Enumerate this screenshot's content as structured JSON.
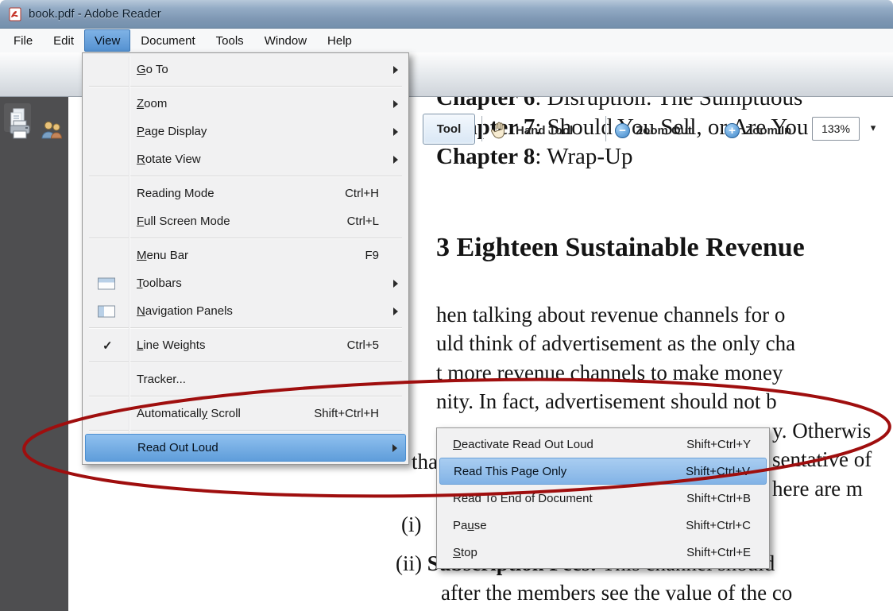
{
  "window": {
    "title": "book.pdf - Adobe Reader"
  },
  "menubar": {
    "items": [
      {
        "label": "File"
      },
      {
        "label": "Edit"
      },
      {
        "label": "View",
        "state": "open"
      },
      {
        "label": "Document"
      },
      {
        "label": "Tools"
      },
      {
        "label": "Window"
      },
      {
        "label": "Help"
      }
    ]
  },
  "toolbar": {
    "tool_button_label": "Tool",
    "hand_tool_label": "Hand Tool",
    "zoom_out_label": "Zoom Out",
    "zoom_in_label": "Zoom In",
    "zoom_value": "133%"
  },
  "glyphs": {
    "check": "✓",
    "dropdown_arrow": "▾",
    "minus": "−",
    "plus": "+"
  },
  "view_menu": {
    "items": [
      {
        "label": "Go To",
        "mnemonic": "G",
        "has_submenu": true
      },
      {
        "label": "Zoom",
        "mnemonic": "Z",
        "has_submenu": true
      },
      {
        "label": "Page Display",
        "mnemonic": "P",
        "has_submenu": true
      },
      {
        "label": "Rotate View",
        "mnemonic": "R",
        "has_submenu": true
      },
      {
        "label": "Reading Mode",
        "shortcut": "Ctrl+H"
      },
      {
        "label": "Full Screen Mode",
        "mnemonic": "F",
        "shortcut": "Ctrl+L"
      },
      {
        "label": "Menu Bar",
        "mnemonic": "M",
        "shortcut": "F9"
      },
      {
        "label": "Toolbars",
        "mnemonic": "T",
        "has_submenu": true
      },
      {
        "label": "Navigation Panels",
        "mnemonic": "N",
        "has_submenu": true
      },
      {
        "label": "Line Weights",
        "mnemonic": "L",
        "shortcut": "Ctrl+5",
        "checked": true
      },
      {
        "label": "Tracker..."
      },
      {
        "label": "Automatically Scroll",
        "mnemonic": "y",
        "shortcut": "Shift+Ctrl+H"
      },
      {
        "label": "Read Out Loud",
        "has_submenu": true,
        "state": "highlighted"
      }
    ]
  },
  "submenu": {
    "items": [
      {
        "label": "Deactivate Read Out Loud",
        "mnemonic": "D",
        "shortcut": "Shift+Ctrl+Y"
      },
      {
        "label": "Read This Page Only",
        "shortcut": "Shift+Ctrl+V",
        "state": "highlighted"
      },
      {
        "label": "Read To End of Document",
        "shortcut": "Shift+Ctrl+B"
      },
      {
        "label": "Pause",
        "mnemonic": "u",
        "shortcut": "Shift+Ctrl+C"
      },
      {
        "label": "Stop",
        "mnemonic": "S",
        "shortcut": "Shift+Ctrl+E"
      }
    ]
  },
  "document": {
    "lines": [
      {
        "bold": "Chapter 6",
        "text": ": Disruption: The Sumptuous"
      },
      {
        "bold": "Chapter 7",
        "text": ": Should You Sell, or Are You"
      },
      {
        "bold": "Chapter 8",
        "text": ": Wrap-Up"
      },
      {
        "heading": "3 Eighteen Sustainable Revenue"
      },
      {
        "text": "hen talking about revenue channels for o"
      },
      {
        "text": "uld think of advertisement as the only cha"
      },
      {
        "text": "t more revenue channels to make money"
      },
      {
        "text": "nity. In fact, advertisement should not b"
      },
      {
        "text": "y. Otherwis"
      },
      {
        "text": "tha"
      },
      {
        "text": "sentative of"
      },
      {
        "text": "here are m"
      },
      {
        "text": "(i)"
      },
      {
        "marker": "(ii)",
        "bold": "Subscription Fees:",
        "text": " This channel should"
      },
      {
        "text": "after the members see the value of the co"
      }
    ]
  },
  "annotation": {
    "type": "ellipse",
    "color": "#9f0e0e"
  }
}
